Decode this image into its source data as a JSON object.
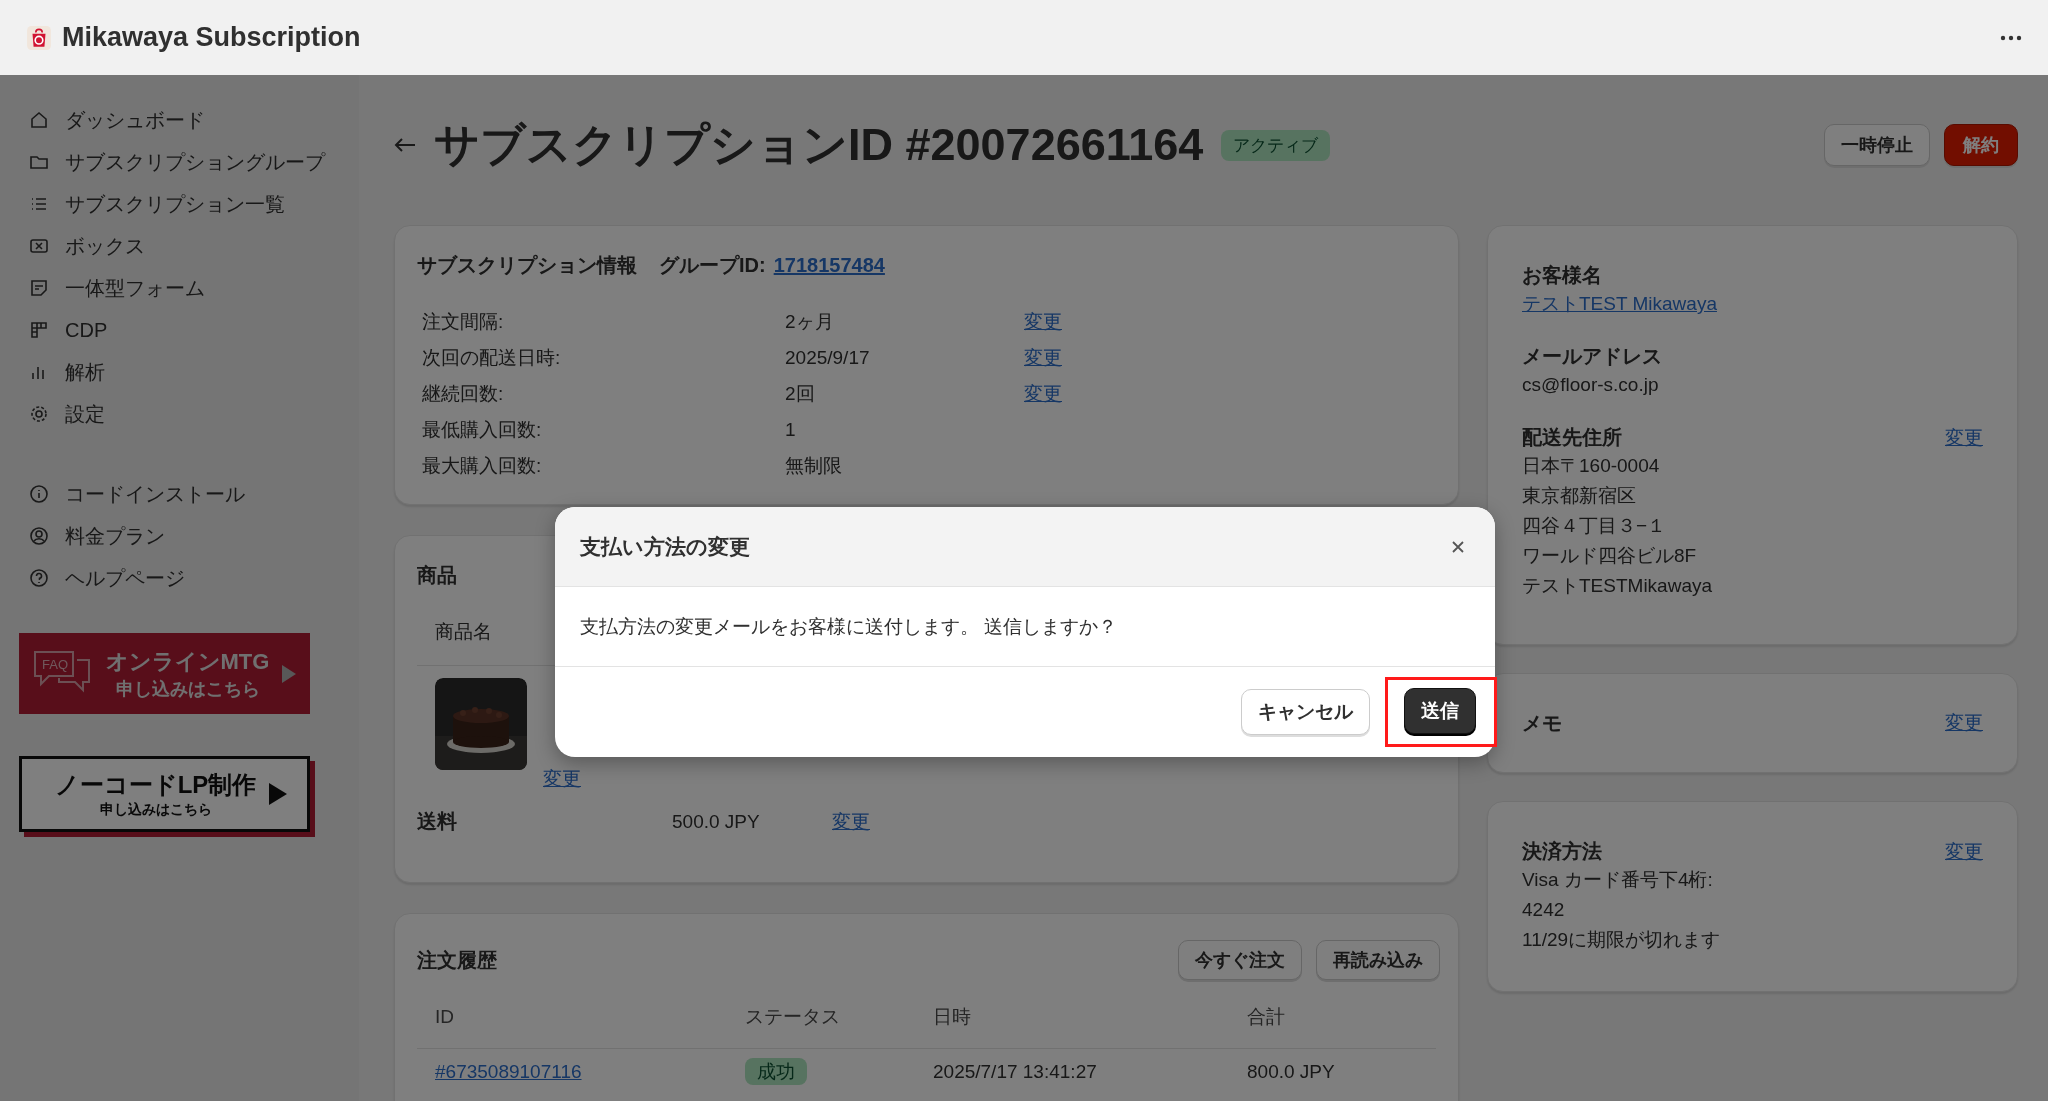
{
  "app": {
    "title": "Mikawaya Subscription"
  },
  "sidebar": {
    "items": [
      {
        "label": "ダッシュボード"
      },
      {
        "label": "サブスクリプショングループ"
      },
      {
        "label": "サブスクリプション一覧"
      },
      {
        "label": "ボックス"
      },
      {
        "label": "一体型フォーム"
      },
      {
        "label": "CDP"
      },
      {
        "label": "解析"
      },
      {
        "label": "設定"
      }
    ],
    "secondary_items": [
      {
        "label": "コードインストール"
      },
      {
        "label": "料金プラン"
      },
      {
        "label": "ヘルプページ"
      }
    ],
    "banners": [
      {
        "kind": "faq",
        "badge": "FAQ",
        "title": "オンラインMTG",
        "subtitle": "申し込みはこちら"
      },
      {
        "kind": "lp",
        "title": "ノーコードLP制作",
        "subtitle": "申し込みはこちら"
      }
    ]
  },
  "page": {
    "title": "サブスクリプションID #20072661164",
    "status": "アクティブ",
    "actions": [
      {
        "label": "一時停止",
        "kind": "secondary"
      },
      {
        "label": "解約",
        "kind": "danger"
      }
    ]
  },
  "info_card": {
    "title": "サブスクリプション情報",
    "group_label": "グループID:",
    "group_id": "1718157484",
    "rows": [
      {
        "label": "注文間隔:",
        "value": "2ヶ月",
        "action": "変更"
      },
      {
        "label": "次回の配送日時:",
        "value": "2025/9/17",
        "action": "変更"
      },
      {
        "label": "継続回数:",
        "value": "2回",
        "action": "変更"
      },
      {
        "label": "最低購入回数:",
        "value": "1"
      },
      {
        "label": "最大購入回数:",
        "value": "無制限"
      }
    ]
  },
  "product_card": {
    "title": "商品",
    "columns": [
      "商品名"
    ],
    "product_action": "変更",
    "shipping": {
      "label": "送料",
      "value": "500.0 JPY",
      "action": "変更"
    }
  },
  "order_history": {
    "title": "注文履歴",
    "buttons": [
      "今すぐ注文",
      "再読み込み"
    ],
    "columns": [
      "ID",
      "ステータス",
      "日時",
      "合計"
    ],
    "rows": [
      {
        "id": "#6735089107116",
        "status": "成功",
        "date": "2025/7/17 13:41:27",
        "total": "800.0 JPY"
      }
    ]
  },
  "customer_card": {
    "sections": [
      {
        "title": "お客様名",
        "lines": [
          "テストTEST Mikawaya"
        ],
        "link": true
      },
      {
        "title": "メールアドレス",
        "lines": [
          "cs@floor-s.co.jp"
        ],
        "link": false
      },
      {
        "title": "配送先住所",
        "action": "変更",
        "lines": [
          "日本〒160-0004",
          "東京都新宿区",
          "四谷４丁目３−１",
          "ワールド四谷ビル8F",
          "テストTESTMikawaya"
        ],
        "link": false
      }
    ]
  },
  "memo_card": {
    "title": "メモ",
    "action": "変更"
  },
  "payment_card": {
    "title": "決済方法",
    "action": "変更",
    "lines": [
      "Visa  カード番号下4桁:",
      "4242",
      "11/29に期限が切れます"
    ]
  },
  "modal": {
    "title": "支払い方法の変更",
    "message": "支払方法の変更メールをお客様に送付します。 送信しますか？",
    "buttons": [
      {
        "label": "キャンセル",
        "kind": "secondary",
        "highlighted": false
      },
      {
        "label": "送信",
        "kind": "primary",
        "highlighted": true
      }
    ]
  }
}
